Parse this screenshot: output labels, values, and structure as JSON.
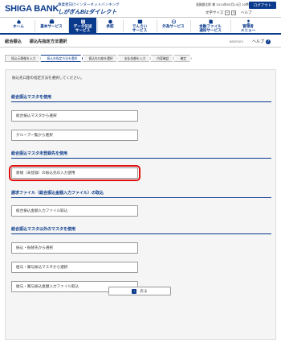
{
  "header": {
    "logo": "SHIGA BANK",
    "sub_line1": "事業者向けインターネットバンキング",
    "sub_line2": "しがぎんBizダイレクト",
    "user_info": "滋賀銀太郎 様 2014年05月14日 10時00分00秒",
    "logout": "ログアウト",
    "text_size_label": "文字サイズ",
    "size_small": "－",
    "size_large": "＋",
    "help": "ヘルプ"
  },
  "nav": [
    {
      "label": "ホーム",
      "icon": "home-icon"
    },
    {
      "label": "基本サービス",
      "icon": "basic-service-icon"
    },
    {
      "label": "データ伝送\nサービス",
      "icon": "data-transfer-icon",
      "active": true
    },
    {
      "label": "承認",
      "icon": "approval-icon"
    },
    {
      "label": "でんさい\nサービス",
      "icon": "densai-icon"
    },
    {
      "label": "外為サービス",
      "icon": "forex-icon"
    },
    {
      "label": "金融ファイル\n通知サービス",
      "icon": "file-notify-icon"
    },
    {
      "label": "管理者\nメニュー",
      "icon": "admin-icon"
    }
  ],
  "title_bar": {
    "category": "総合振込",
    "page_title": "振込先指定方法選択",
    "screen_code": "BSSF003",
    "help": "ヘルプ"
  },
  "steps": [
    "振込元情報を入力",
    "振込先指定方法を選択",
    "振込先口座を選択",
    "支払金額を入力",
    "内容確認",
    "確定"
  ],
  "current_step": 1,
  "intro": "振込先口座の指定方法を選択してください。",
  "sections": [
    {
      "title": "総合振込マスタを使用",
      "buttons": [
        "総合振込マスタから選択",
        "グループ一覧から選択"
      ]
    },
    {
      "title": "総合振込マスタ未登録先を使用",
      "buttons": [
        "新規（未登録）の振込先の入力使用"
      ]
    },
    {
      "title": "請求ファイル（総合振込金額入力ファイル）の取込",
      "buttons": [
        "総合振込金額入力ファイル取込"
      ]
    },
    {
      "title": "総合振込マスタ以外のマスタを使用",
      "buttons": [
        "振込・振替先から選択",
        "給与・賞与振込マスタから選択",
        "給与・賞与振込金額入力ファイル取込"
      ]
    }
  ],
  "back_button": "戻る",
  "colors": {
    "brand": "#0a3a8c",
    "highlight": "#e01010"
  }
}
